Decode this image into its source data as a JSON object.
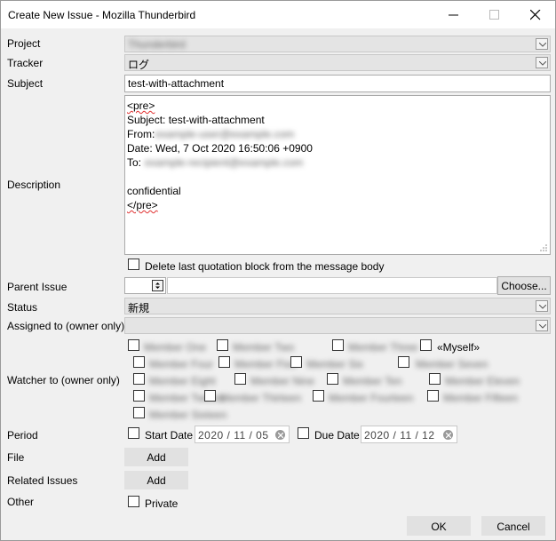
{
  "window": {
    "title": "Create New Issue - Mozilla Thunderbird"
  },
  "labels": {
    "project": "Project",
    "tracker": "Tracker",
    "subject": "Subject",
    "description": "Description",
    "parent_issue": "Parent Issue",
    "status": "Status",
    "assigned_to": "Assigned to (owner only)",
    "watcher_to": "Watcher to (owner only)",
    "period": "Period",
    "file": "File",
    "related_issues": "Related Issues",
    "other": "Other"
  },
  "form": {
    "project_value": "Thunderbird",
    "tracker_value": "ログ",
    "subject_value": "test-with-attachment",
    "description_lines": {
      "pre_open": "<pre>",
      "subject_line": "Subject: test-with-attachment",
      "from_label": "From:",
      "from_value": "example-user@example.com",
      "date_line": "Date: Wed, 7 Oct 2020 16:50:06 +0900",
      "to_label": "To:",
      "to_value": "example-recipient@example.com",
      "confidential": "confidential",
      "pre_close": "</pre>"
    },
    "delete_quotation_label": "Delete last quotation block from the message body",
    "choose_button": "Choose...",
    "status_value": "新規",
    "assigned_value": "",
    "watchers": {
      "row1": [
        "Member One",
        "Member Two",
        "Member Three"
      ],
      "myself": "«Myself»",
      "row2": [
        "Member Four",
        "Member Five",
        "Member Six",
        "Member Seven"
      ],
      "row3": [
        "Member Eight",
        "Member Nine",
        "Member Ten",
        "Member Eleven"
      ],
      "row4": [
        "Member Twelve",
        "Member Thirteen",
        "Member Fourteen",
        "Member Fifteen"
      ],
      "row5": [
        "Member Sixteen"
      ]
    },
    "start_date_label": "Start Date",
    "start_date_value": "2020 / 11 / 05",
    "due_date_label": "Due Date",
    "due_date_value": "2020 / 11 / 12",
    "file_add_button": "Add",
    "related_add_button": "Add",
    "private_label": "Private"
  },
  "footer": {
    "ok_button": "OK",
    "cancel_button": "Cancel"
  }
}
